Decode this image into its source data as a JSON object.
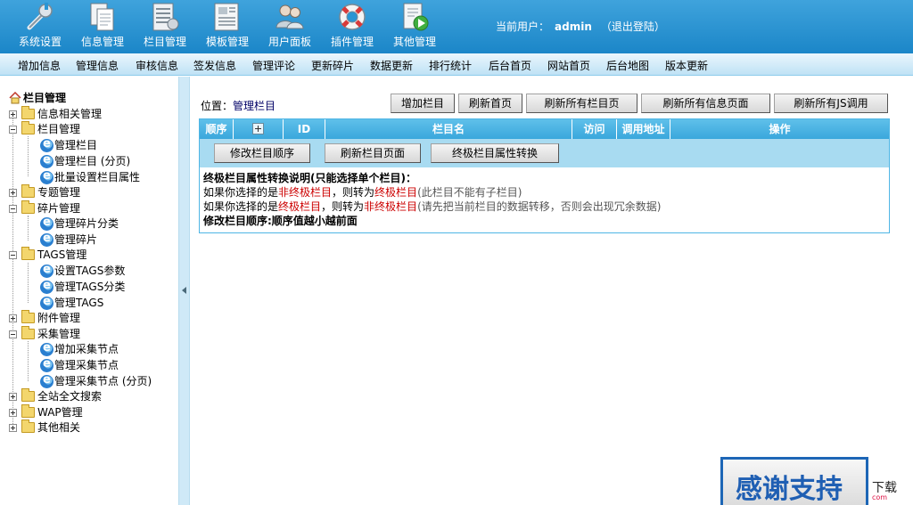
{
  "topnav": [
    {
      "label": "系统设置",
      "icon": "wrench-icon"
    },
    {
      "label": "信息管理",
      "icon": "documents-icon"
    },
    {
      "label": "栏目管理",
      "icon": "column-list-icon"
    },
    {
      "label": "模板管理",
      "icon": "template-icon"
    },
    {
      "label": "用户面板",
      "icon": "users-icon"
    },
    {
      "label": "插件管理",
      "icon": "lifebuoy-icon"
    },
    {
      "label": "其他管理",
      "icon": "document-play-icon"
    }
  ],
  "user": {
    "prefix": "当前用户：",
    "name": "admin",
    "logout": "（退出登陆）"
  },
  "subnav": [
    "增加信息",
    "管理信息",
    "审核信息",
    "签发信息",
    "管理评论",
    "更新碎片",
    "数据更新",
    "排行统计",
    "后台首页",
    "网站首页",
    "后台地图",
    "版本更新"
  ],
  "tree": {
    "root": "栏目管理",
    "items": [
      "信息相关管理",
      "栏目管理",
      "管理栏目",
      "管理栏目 (分页)",
      "批量设置栏目属性",
      "专题管理",
      "碎片管理",
      "管理碎片分类",
      "管理碎片",
      "TAGS管理",
      "设置TAGS参数",
      "管理TAGS分类",
      "管理TAGS",
      "附件管理",
      "采集管理",
      "增加采集节点",
      "管理采集节点",
      "管理采集节点 (分页)",
      "全站全文搜索",
      "WAP管理",
      "其他相关"
    ]
  },
  "main": {
    "location_prefix": "位置：",
    "location_link": "管理栏目",
    "top_buttons": [
      "增加栏目",
      "刷新首页",
      "刷新所有栏目页",
      "刷新所有信息页面",
      "刷新所有JS调用"
    ],
    "columns": [
      "顺序",
      "ID",
      "栏目名",
      "访问",
      "调用地址",
      "操作"
    ],
    "action_buttons": [
      "修改栏目顺序",
      "刷新栏目页面",
      "终极栏目属性转换"
    ],
    "notes": {
      "title": "终极栏目属性转换说明(只能选择单个栏目)：",
      "l1_a": "如果你选择的是",
      "l1_b": "非终极栏目",
      "l1_c": "，则转为",
      "l1_d": "终极栏目",
      "l1_e": "(此栏目不能有子栏目)",
      "l2_a": "如果你选择的是",
      "l2_b": "终极栏目",
      "l2_c": "，则转为",
      "l2_d": "非终极栏目",
      "l2_e": "(请先把当前栏目的数据转移，否则会出现冗余数据)",
      "l3": "修改栏目顺序:顺序值越小越前面"
    }
  },
  "badge": {
    "thanks": "感谢支持",
    "download": "下载",
    "small": "com"
  },
  "colors": {
    "header_blue": "#2a95d4",
    "table_header": "#4ab2e2",
    "note_red": "#cc0000"
  }
}
